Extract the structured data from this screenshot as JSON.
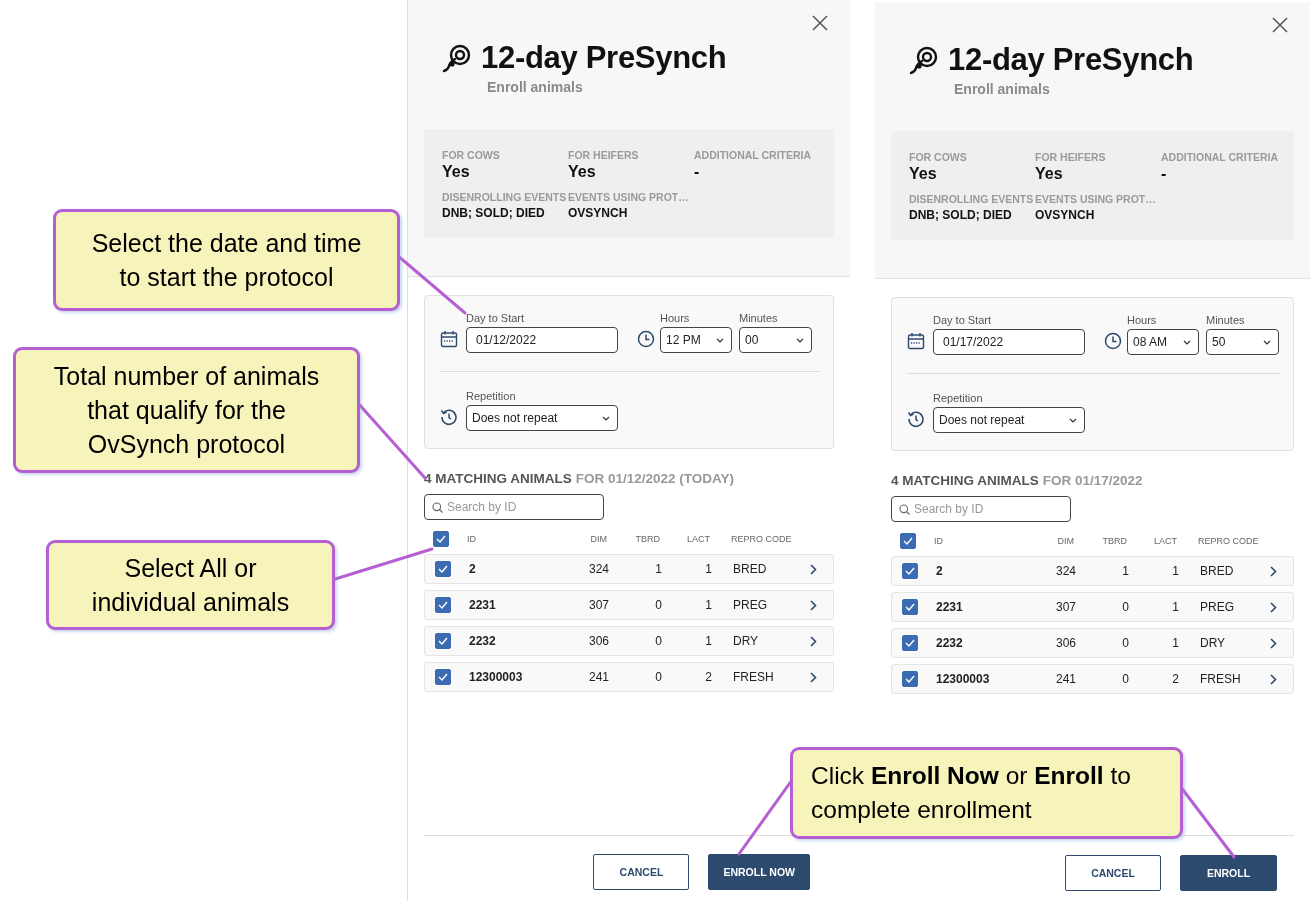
{
  "callouts": [
    {
      "text": "Select the date and time to start the protocol"
    },
    {
      "text": "Total number of animals that qualify for the OvSynch protocol"
    },
    {
      "text": "Select All or individual animals"
    },
    {
      "text": "Click **Enroll Now** or **Enroll** to complete enrollment"
    }
  ],
  "panels": [
    {
      "title": "12-day PreSynch",
      "subtitle": "Enroll animals",
      "criteria": [
        {
          "label": "FOR COWS",
          "value": "Yes",
          "kind": "main"
        },
        {
          "label": "FOR HEIFERS",
          "value": "Yes",
          "kind": "main"
        },
        {
          "label": "ADDITIONAL CRITERIA",
          "value": "-",
          "kind": "main"
        },
        {
          "label": "DISENROLLING EVENTS",
          "value": "DNB; SOLD; DIED",
          "kind": "list"
        },
        {
          "label": "EVENTS USING PROT…",
          "value": "OVSYNCH",
          "kind": "list"
        }
      ],
      "day_label": "Day to Start",
      "day_value": "01/12/2022",
      "hours_label": "Hours",
      "hours_value": "12 PM",
      "minutes_label": "Minutes",
      "minutes_value": "00",
      "repetition_label": "Repetition",
      "repetition_value": "Does not repeat",
      "matching_count": "4 MATCHING ANIMALS",
      "matching_date": "FOR 01/12/2022 (TODAY)",
      "search_placeholder": "Search by ID",
      "select_all_checked": true,
      "columns": [
        "ID",
        "DIM",
        "TBRD",
        "LACT",
        "REPRO CODE"
      ],
      "rows": [
        {
          "checked": true,
          "cells": [
            "2",
            "324",
            "1",
            "1",
            "BRED"
          ]
        },
        {
          "checked": true,
          "cells": [
            "2231",
            "307",
            "0",
            "1",
            "PREG"
          ]
        },
        {
          "checked": true,
          "cells": [
            "2232",
            "306",
            "0",
            "1",
            "DRY"
          ]
        },
        {
          "checked": true,
          "cells": [
            "12300003",
            "241",
            "0",
            "2",
            "FRESH"
          ]
        }
      ],
      "buttons": [
        {
          "label": "CANCEL",
          "kind": "secondary"
        },
        {
          "label": "ENROLL NOW",
          "kind": "primary"
        }
      ]
    },
    {
      "title": "12-day PreSynch",
      "subtitle": "Enroll animals",
      "criteria": [
        {
          "label": "FOR COWS",
          "value": "Yes",
          "kind": "main"
        },
        {
          "label": "FOR HEIFERS",
          "value": "Yes",
          "kind": "main"
        },
        {
          "label": "ADDITIONAL CRITERIA",
          "value": "-",
          "kind": "main"
        },
        {
          "label": "DISENROLLING EVENTS",
          "value": "DNB; SOLD; DIED",
          "kind": "list"
        },
        {
          "label": "EVENTS USING PROT…",
          "value": "OVSYNCH",
          "kind": "list"
        }
      ],
      "day_label": "Day to Start",
      "day_value": "01/17/2022",
      "hours_label": "Hours",
      "hours_value": "08 AM",
      "minutes_label": "Minutes",
      "minutes_value": "50",
      "repetition_label": "Repetition",
      "repetition_value": "Does not repeat",
      "matching_count": "4 MATCHING ANIMALS",
      "matching_date": "FOR 01/17/2022",
      "search_placeholder": "Search by ID",
      "select_all_checked": true,
      "columns": [
        "ID",
        "DIM",
        "TBRD",
        "LACT",
        "REPRO CODE"
      ],
      "rows": [
        {
          "checked": true,
          "cells": [
            "2",
            "324",
            "1",
            "1",
            "BRED"
          ]
        },
        {
          "checked": true,
          "cells": [
            "2231",
            "307",
            "0",
            "1",
            "PREG"
          ]
        },
        {
          "checked": true,
          "cells": [
            "2232",
            "306",
            "0",
            "1",
            "DRY"
          ]
        },
        {
          "checked": true,
          "cells": [
            "12300003",
            "241",
            "0",
            "2",
            "FRESH"
          ]
        }
      ],
      "buttons": [
        {
          "label": "CANCEL",
          "kind": "secondary"
        },
        {
          "label": "ENROLL",
          "kind": "primary"
        }
      ]
    }
  ]
}
